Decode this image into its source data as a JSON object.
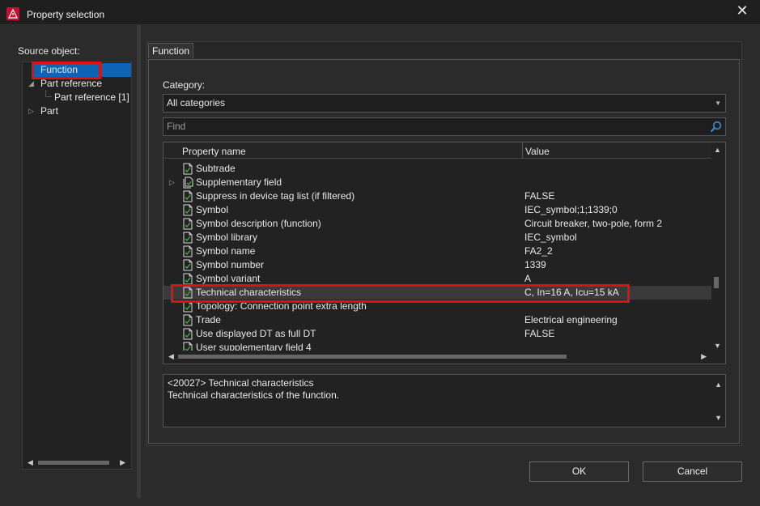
{
  "window": {
    "title": "Property selection",
    "close_glyph": "✕"
  },
  "source": {
    "label": "Source object:",
    "tree": [
      {
        "label": "Function",
        "selected": true,
        "expander": "",
        "level": 0
      },
      {
        "label": "Part reference",
        "selected": false,
        "expander": "◢",
        "level": 0
      },
      {
        "label": "Part reference [1]",
        "selected": false,
        "expander": "",
        "level": 1
      },
      {
        "label": "Part",
        "selected": false,
        "expander": "▷",
        "level": 0
      }
    ]
  },
  "tab": {
    "label": "Function"
  },
  "category": {
    "label": "Category:",
    "value": "All categories"
  },
  "find": {
    "placeholder": "Find"
  },
  "grid": {
    "headers": {
      "name": "Property name",
      "value": "Value"
    },
    "rows": [
      {
        "name": "Subtrade",
        "value": "",
        "expander": "",
        "highlight": false
      },
      {
        "name": "Supplementary field",
        "value": "",
        "expander": "▷",
        "highlight": false,
        "multi": true
      },
      {
        "name": "Suppress in device tag list (if filtered)",
        "value": "FALSE",
        "expander": "",
        "highlight": false
      },
      {
        "name": "Symbol",
        "value": "IEC_symbol;1;1339;0",
        "expander": "",
        "highlight": false
      },
      {
        "name": "Symbol description (function)",
        "value": "Circuit breaker, two-pole, form 2",
        "expander": "",
        "highlight": false
      },
      {
        "name": "Symbol library",
        "value": "IEC_symbol",
        "expander": "",
        "highlight": false
      },
      {
        "name": "Symbol name",
        "value": "FA2_2",
        "expander": "",
        "highlight": false
      },
      {
        "name": "Symbol number",
        "value": "1339",
        "expander": "",
        "highlight": false
      },
      {
        "name": "Symbol variant",
        "value": "A",
        "expander": "",
        "highlight": false
      },
      {
        "name": "Technical characteristics",
        "value": "C, In=16 A, Icu=15 kA",
        "expander": "",
        "highlight": true
      },
      {
        "name": "Topology: Connection point extra length",
        "value": "",
        "expander": "",
        "highlight": false
      },
      {
        "name": "Trade",
        "value": "Electrical engineering",
        "expander": "",
        "highlight": false
      },
      {
        "name": "Use displayed DT as full DT",
        "value": "FALSE",
        "expander": "",
        "highlight": false
      },
      {
        "name": "User supplementary field 4",
        "value": "",
        "expander": "",
        "highlight": false
      }
    ]
  },
  "description": {
    "line1": "<20027> Technical characteristics",
    "line2": "Technical characteristics of the function."
  },
  "buttons": {
    "ok": "OK",
    "cancel": "Cancel"
  },
  "colors": {
    "highlight_box": "#e01010",
    "selection": "#0e64b4"
  }
}
